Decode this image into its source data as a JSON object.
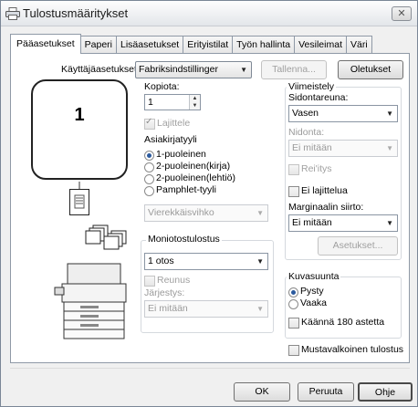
{
  "window": {
    "title": "Tulostusmääritykset",
    "close_label": "✕"
  },
  "tabs": [
    "Pääasetukset",
    "Paperi",
    "Lisäasetukset",
    "Erityistilat",
    "Työn hallinta",
    "Vesileimat",
    "Väri"
  ],
  "settings_row": {
    "label": "Käyttäjäasetukset:",
    "value": "Fabriksindstillinger",
    "save_label": "Tallenna...",
    "default_label": "Oletukset"
  },
  "preview": {
    "page_number": "1"
  },
  "copies": {
    "label": "Kopiota:",
    "value": "1",
    "collate_label": "Lajittele"
  },
  "document_style": {
    "title": "Asiakirjatyyli",
    "options": [
      "1-puoleinen",
      "2-puoleinen(kirja)",
      "2-puoleinen(lehtiö)",
      "Pamphlet-tyyli"
    ],
    "selected": "1-puoleinen",
    "booklet_value": "Vierekkäisvihko"
  },
  "multi_up": {
    "title": "Moniotostulostus",
    "value": "1 otos",
    "border_label": "Reunus",
    "order_label": "Järjestys:",
    "order_value": "Ei mitään"
  },
  "finishing": {
    "title": "Viimeistely",
    "binding_label": "Sidontareuna:",
    "binding_value": "Vasen",
    "staple_label": "Nidonta:",
    "staple_value": "Ei mitään",
    "punch_label": "Rei'itys",
    "offset_label": "Ei lajittelua",
    "margin_label": "Marginaalin siirto:",
    "margin_value": "Ei mitään",
    "margin_settings_label": "Asetukset..."
  },
  "orientation": {
    "title": "Kuvasuunta",
    "options": [
      "Pysty",
      "Vaaka"
    ],
    "selected": "Pysty",
    "rotate_label": "Käännä 180 astetta"
  },
  "mono_label": "Mustavalkoinen tulostus",
  "buttons": {
    "ok": "OK",
    "cancel": "Peruuta",
    "help": "Ohje"
  }
}
